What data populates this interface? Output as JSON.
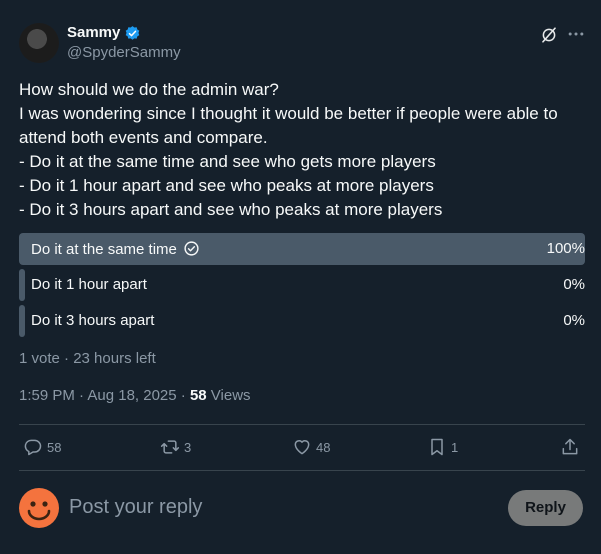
{
  "author": {
    "display_name": "Sammy",
    "handle": "@SpyderSammy"
  },
  "tweet": {
    "lines": [
      "How should we do the admin war?",
      "I was wondering since I thought it would be better if people were able to",
      "attend both events and compare.",
      "- Do it at the same time and see who gets more players",
      "- Do it 1 hour apart and see who peaks at more players",
      "- Do it 3 hours apart and see who peaks at more players"
    ]
  },
  "poll": {
    "options": [
      {
        "label": "Do it at the same time",
        "percent_text": "100%",
        "fraction": 1.0,
        "selected": true
      },
      {
        "label": "Do it 1 hour apart",
        "percent_text": "0%",
        "fraction": 0.0,
        "selected": false
      },
      {
        "label": "Do it 3 hours apart",
        "percent_text": "0%",
        "fraction": 0.0,
        "selected": false
      }
    ],
    "meta": "1 vote · 23 hours left"
  },
  "timestamp": {
    "time": "1:59 PM · Aug 18, 2025 · ",
    "views_count": "58",
    "views_label": " Views"
  },
  "actions": {
    "replies": "58",
    "reposts": "3",
    "likes": "48",
    "bookmarks": "1"
  },
  "reply_box": {
    "placeholder": "Post your reply",
    "button_label": "Reply"
  },
  "colors": {
    "background": "#15202b",
    "verified": "#1d9bf0",
    "poll_fill": "#4a5a69",
    "muted_text": "#8b98a5",
    "reply_avatar": "#f4733e"
  },
  "icons": {
    "verified": "verified-badge-icon",
    "grok": "grok-icon",
    "more": "more-icon",
    "reply": "reply-icon",
    "repost": "repost-icon",
    "like": "heart-icon",
    "bookmark": "bookmark-icon",
    "share": "share-icon",
    "poll_check": "check-circle-icon"
  }
}
